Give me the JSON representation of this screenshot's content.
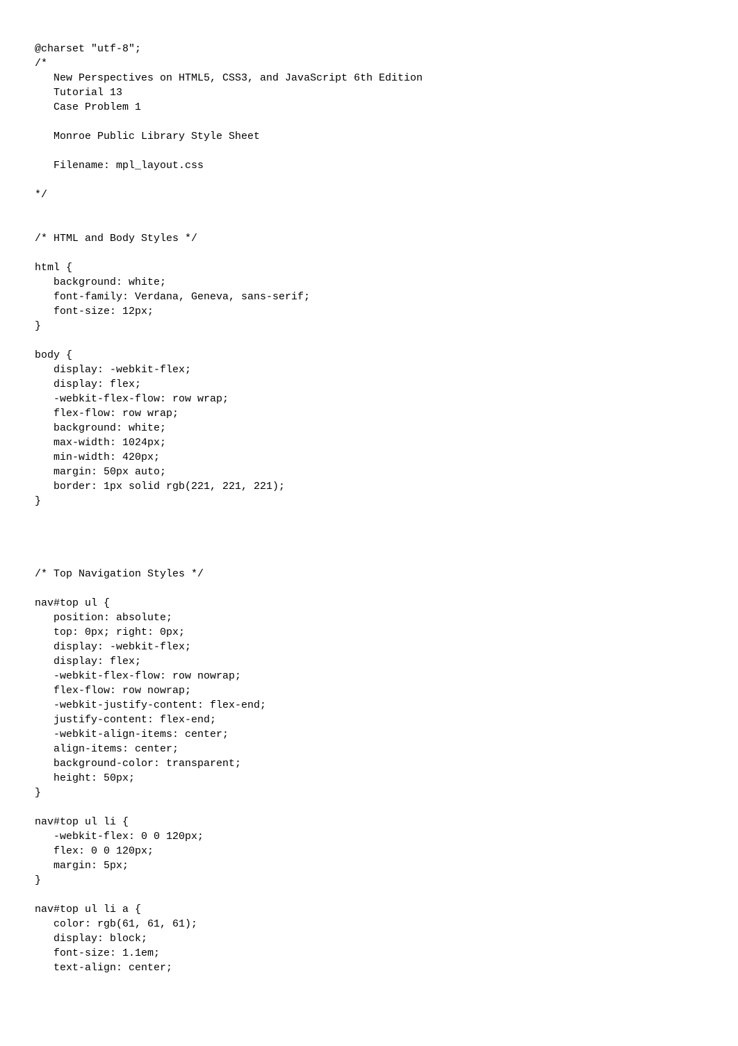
{
  "lines": [
    "@charset \"utf-8\";",
    "/*",
    "   New Perspectives on HTML5, CSS3, and JavaScript 6th Edition",
    "   Tutorial 13",
    "   Case Problem 1",
    "",
    "   Monroe Public Library Style Sheet",
    "",
    "   Filename: mpl_layout.css",
    "",
    "*/",
    "",
    "",
    "/* HTML and Body Styles */",
    "",
    "html {",
    "   background: white;",
    "   font-family: Verdana, Geneva, sans-serif;",
    "   font-size: 12px;",
    "}",
    "",
    "body {",
    "   display: -webkit-flex;",
    "   display: flex;",
    "   -webkit-flex-flow: row wrap;",
    "   flex-flow: row wrap;",
    "   background: white;",
    "   max-width: 1024px;",
    "   min-width: 420px;",
    "   margin: 50px auto;",
    "   border: 1px solid rgb(221, 221, 221);",
    "}",
    "",
    "",
    "",
    "",
    "/* Top Navigation Styles */",
    "",
    "nav#top ul {",
    "   position: absolute;",
    "   top: 0px; right: 0px;",
    "   display: -webkit-flex;",
    "   display: flex;",
    "   -webkit-flex-flow: row nowrap;",
    "   flex-flow: row nowrap;",
    "   -webkit-justify-content: flex-end;",
    "   justify-content: flex-end;",
    "   -webkit-align-items: center;",
    "   align-items: center;",
    "   background-color: transparent;",
    "   height: 50px;",
    "}",
    "",
    "nav#top ul li {",
    "   -webkit-flex: 0 0 120px;",
    "   flex: 0 0 120px;",
    "   margin: 5px;",
    "}",
    "",
    "nav#top ul li a {",
    "   color: rgb(61, 61, 61);",
    "   display: block;",
    "   font-size: 1.1em;",
    "   text-align: center;"
  ]
}
